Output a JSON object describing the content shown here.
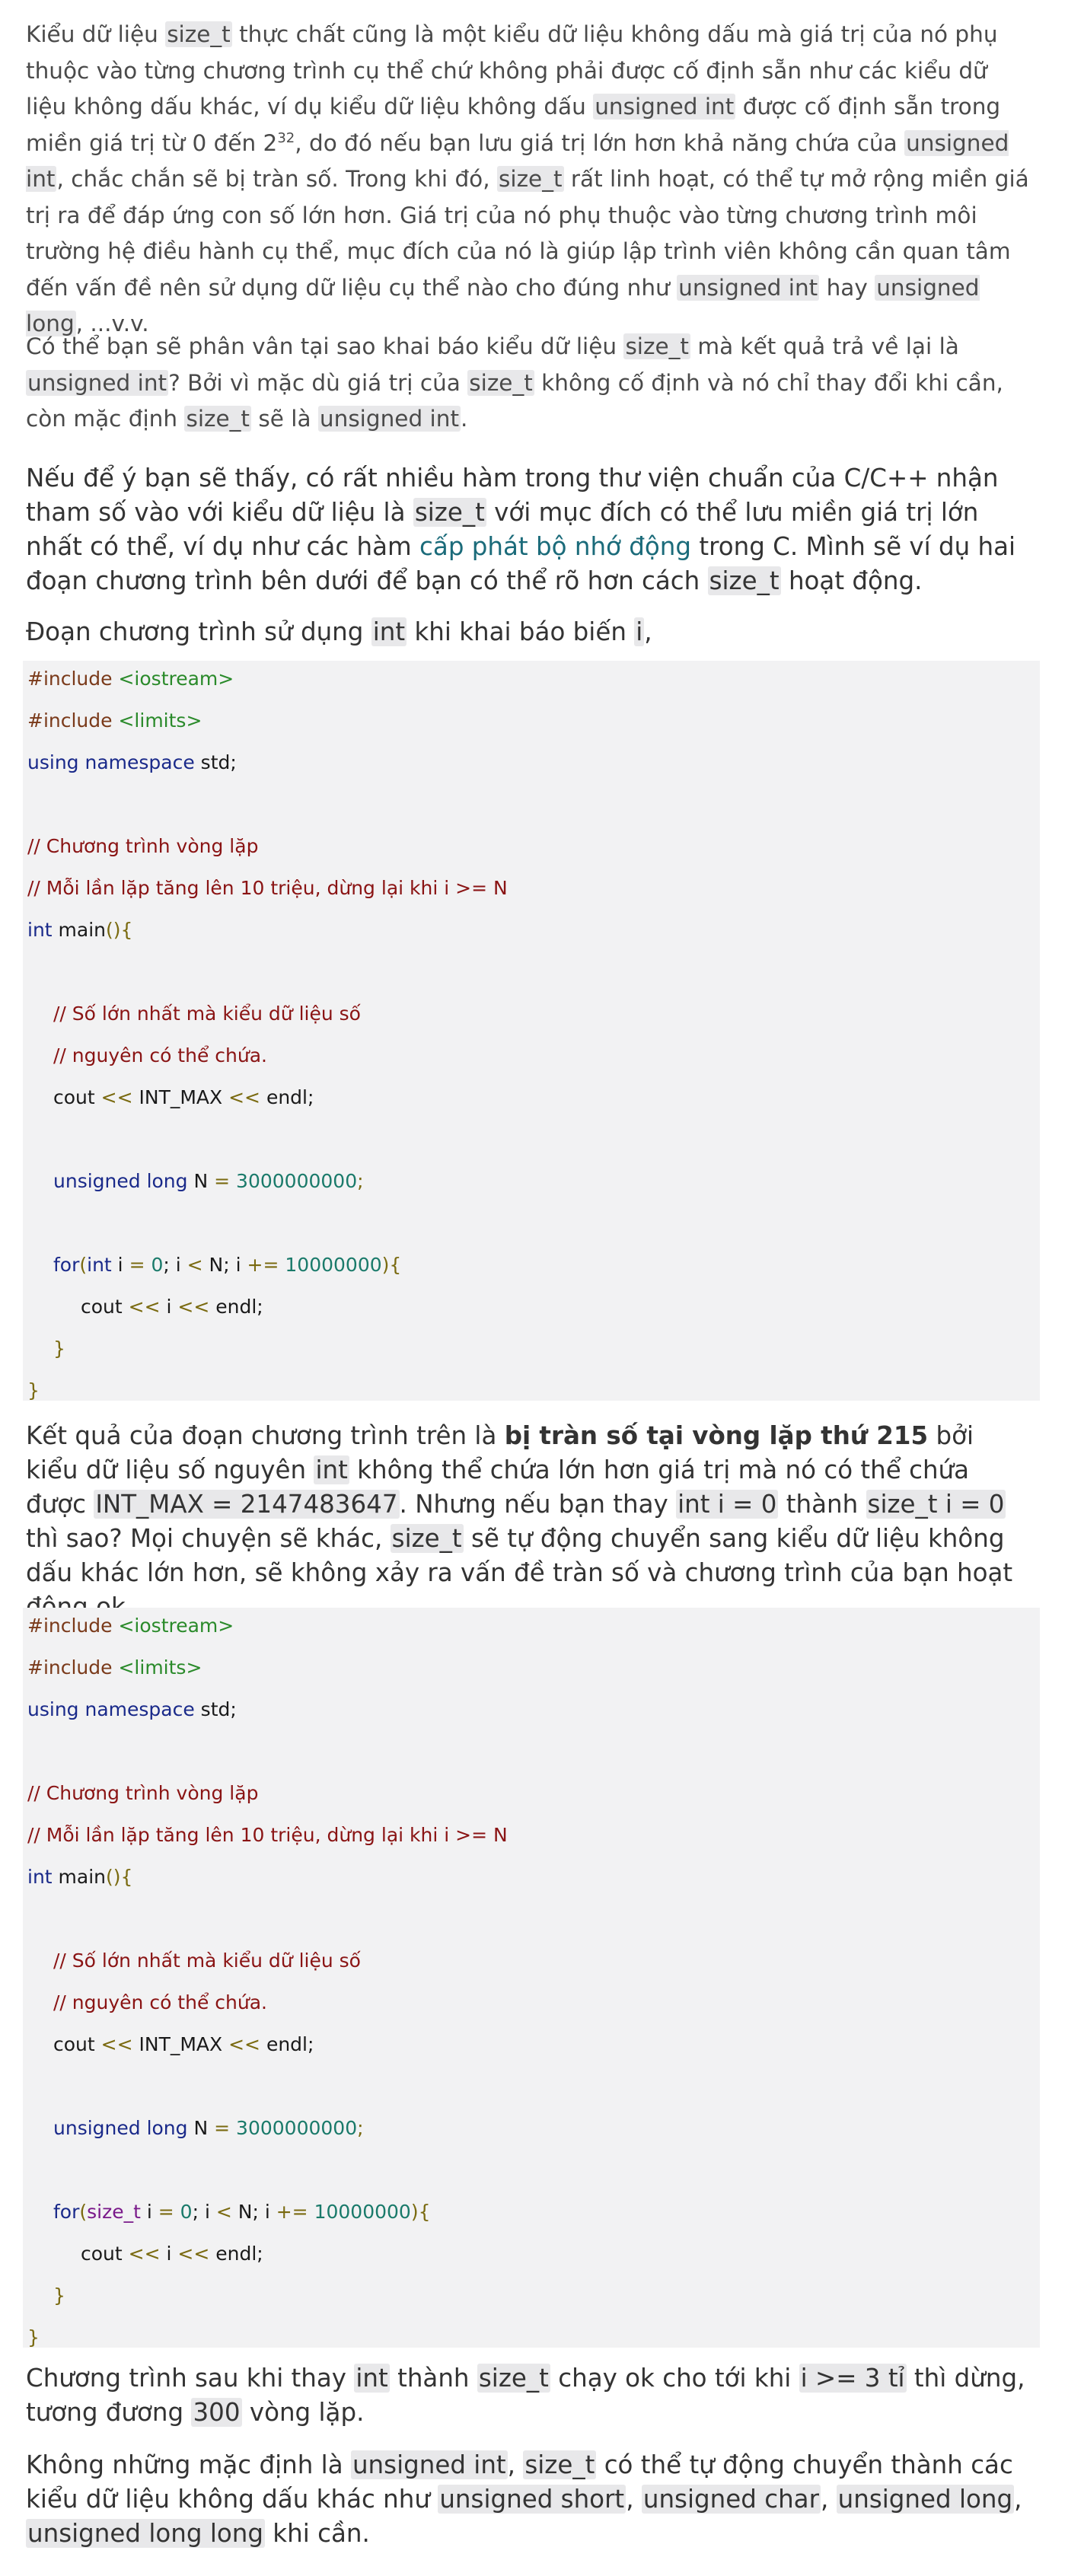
{
  "p1": {
    "t1": "Kiểu dữ liệu ",
    "c1": "size_t",
    "t2": " thực chất cũng là một kiểu dữ liệu không dấu mà giá trị của nó phụ thuộc vào từng chương trình cụ thể chứ không phải được cố định sẵn như các kiểu dữ liệu không dấu khác, ví dụ kiểu dữ liệu không dấu ",
    "c2": "unsigned int",
    "t3": " được cố định sẵn trong miền giá trị từ 0 đến 2",
    "sup": "32",
    "t4": ", do đó nếu bạn lưu giá trị lớn hơn khả năng chứa của ",
    "c3": "unsigned int",
    "t5": ", chắc chắn sẽ bị tràn số. Trong khi đó, ",
    "c4": "size_t",
    "t6": " rất linh hoạt, có thể tự mở rộng miền giá trị ra để đáp ứng con số lớn hơn. Giá trị của nó phụ thuộc vào từng chương trình môi trường hệ điều hành cụ thể, mục đích của nó là giúp lập trình viên không cần quan tâm đến vấn đề nên sử dụng dữ liệu cụ thể nào cho đúng như ",
    "c5": "unsigned int",
    "t7": " hay ",
    "c6": "unsigned long",
    "t8": ", ...v.v."
  },
  "p2": {
    "t1": "Có thể bạn sẽ phân vân tại sao khai báo kiểu dữ liệu ",
    "c1": "size_t",
    "t2": " mà kết quả trả về lại là ",
    "c2": "unsigned int",
    "t3": "? Bởi vì mặc dù giá trị của ",
    "c3": "size_t",
    "t4": " không cố định và nó chỉ thay đổi khi cần, còn mặc định ",
    "c4": "size_t",
    "t5": " sẽ là ",
    "c5": "unsigned int",
    "t6": "."
  },
  "p3": {
    "t1": "Nếu để ý bạn sẽ thấy, có rất nhiều hàm trong thư viện chuẩn của C/C++ nhận tham số vào với kiểu dữ liệu là ",
    "c1": "size_t",
    "t2": " với mục đích có thể lưu miền giá trị lớn nhất có thể, ví dụ như các hàm ",
    "link": "cấp phát bộ nhớ động",
    "t3": " trong C. Mình sẽ ví dụ hai đoạn chương trình bên dưới để bạn có thể rõ hơn cách ",
    "c2": "size_t",
    "t4": " hoạt động."
  },
  "p4": {
    "t1": "Đoạn chương trình sử dụng ",
    "c1": "int",
    "t2": " khi khai báo biến ",
    "c2": "i",
    "t3": ","
  },
  "code1": {
    "inc_kw": "#include",
    "inc1": "<iostream>",
    "inc2": "<limits>",
    "using": "using",
    "namespace": "namespace",
    "std": " std;",
    "cm1": "// Chương trình vòng lặp",
    "cm2": "// Mỗi lần lặp tăng lên 10 triệu, dừng lại khi i >= N",
    "int_kw": "int",
    "main": " main",
    "main_br": "(){",
    "cm3": "// Số lớn nhất mà kiểu dữ liệu số",
    "cm4": "// nguyên có thể chứa.",
    "cout1_a": "cout ",
    "op_ll": "<<",
    "cout1_b": " INT_MAX ",
    "endl": " endl;",
    "ul_kw": "unsigned long",
    "n_decl": " N ",
    "eq": "=",
    "n_val": " 3000000000",
    "semi": ";",
    "for_kw": "for",
    "for_open": "(",
    "for_type": "int",
    "for_i": " i ",
    "zero": " 0",
    "for_mid": "; i ",
    "lt": "<",
    "for_n": " N; i ",
    "pluseq": "+=",
    "step": " 10000000",
    "for_close": "){",
    "cout2_a": "cout ",
    "cout2_b": " i ",
    "close_inner": "}",
    "close_outer": "}"
  },
  "p5": {
    "t1": "Kết quả của đoạn chương trình trên là ",
    "b1": "bị tràn số tại vòng lặp thứ 215",
    "t2": " bởi kiểu dữ liệu số nguyên ",
    "c1": "int",
    "t3": " không thể chứa lớn hơn giá trị mà nó có thể chứa được ",
    "c2": "INT_MAX = 2147483647",
    "t4": ". Nhưng nếu bạn thay ",
    "c3": "int i = 0",
    "t5": " thành ",
    "c4": "size_t i = 0",
    "t6": " thì sao? Mọi chuyện sẽ khác, ",
    "c5": "size_t",
    "t7": " sẽ tự động chuyển sang kiểu dữ liệu không dấu khác lớn hơn, sẽ không xảy ra vấn đề tràn số và chương trình của bạn hoạt động ok."
  },
  "code2": {
    "for_type": "size_t"
  },
  "p6": {
    "t1": "Chương trình sau khi thay ",
    "c1": "int",
    "t2": " thành ",
    "c2": "size_t",
    "t3": " chạy ok cho tới khi ",
    "c3": "i >= 3 tỉ",
    "t4": " thì dừng, tương đương ",
    "c4": "300",
    "t5": " vòng lặp."
  },
  "p7": {
    "t1": "Không những mặc định là ",
    "c1": "unsigned int",
    "t2": ", ",
    "c2": "size_t",
    "t3": " có thể tự động chuyển thành các kiểu dữ liệu không dấu khác như ",
    "c3": "unsigned short",
    "t4": ", ",
    "c4": "unsigned char",
    "t5": ", ",
    "c5": "unsigned long",
    "t6": ", ",
    "c6": "unsigned long long",
    "t7": " khi cần."
  },
  "colors": {
    "code_bg": "#f2f2f3",
    "inline_code_bg": "#e8e8ea",
    "link": "#1b6b7a",
    "comment": "#8a1414",
    "include_path": "#2a8a2a",
    "keyword": "#1a2a8a",
    "number": "#1a7a6a"
  }
}
